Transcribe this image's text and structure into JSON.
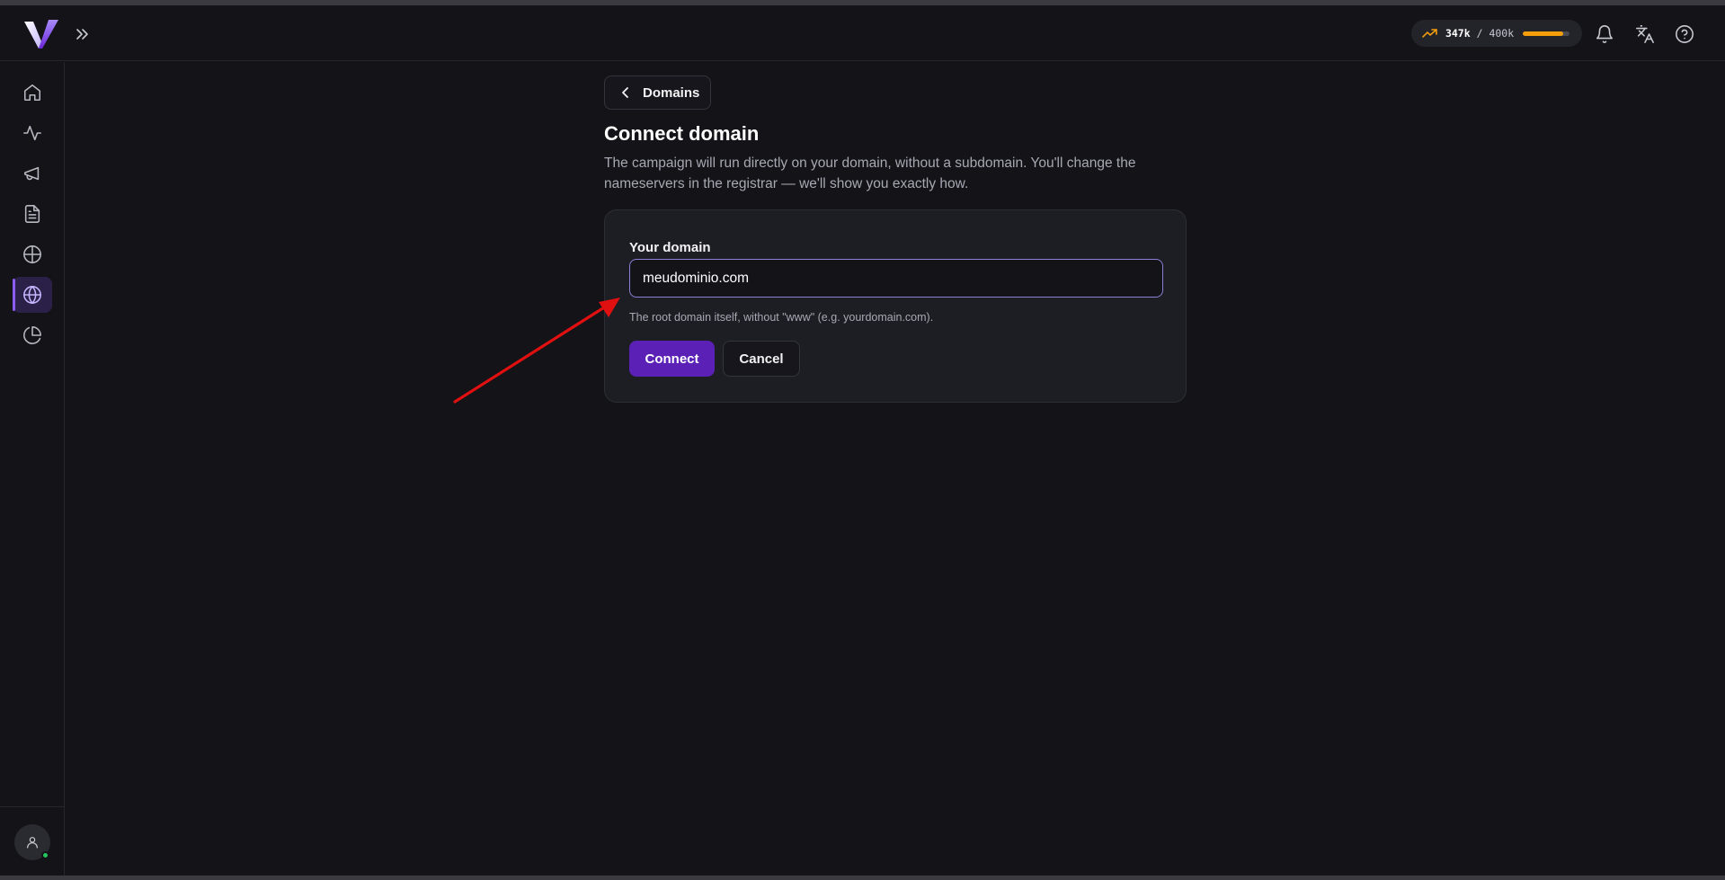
{
  "header": {
    "usage": {
      "current": "347k",
      "separator": " / ",
      "limit": "400k",
      "fraction": 0.8675,
      "color": "#f59e0b"
    },
    "icons": [
      "bell-icon",
      "translate-icon",
      "help-icon"
    ]
  },
  "sidebar": {
    "items": [
      {
        "name": "home",
        "icon": "home-icon",
        "active": false
      },
      {
        "name": "activity",
        "icon": "activity-icon",
        "active": false
      },
      {
        "name": "campaigns",
        "icon": "megaphone-icon",
        "active": false
      },
      {
        "name": "documents",
        "icon": "document-icon",
        "active": false
      },
      {
        "name": "networks",
        "icon": "crosshair-globe-icon",
        "active": false
      },
      {
        "name": "domains",
        "icon": "globe-icon",
        "active": true
      },
      {
        "name": "reports",
        "icon": "pie-chart-icon",
        "active": false
      }
    ],
    "accent": "#8b5cf6"
  },
  "main": {
    "back_label": "Domains",
    "title": "Connect domain",
    "description": "The campaign will run directly on your domain, without a subdomain. You'll change the nameservers in the registrar — we'll show you exactly how.",
    "form": {
      "label": "Your domain",
      "value": "meudominio.com",
      "hint": "The root domain itself, without \"www\" (e.g. yourdomain.com).",
      "connect_label": "Connect",
      "cancel_label": "Cancel"
    }
  },
  "colors": {
    "background": "#131318",
    "primary_button": "#5b21b6",
    "annotation_arrow": "#e01010"
  }
}
